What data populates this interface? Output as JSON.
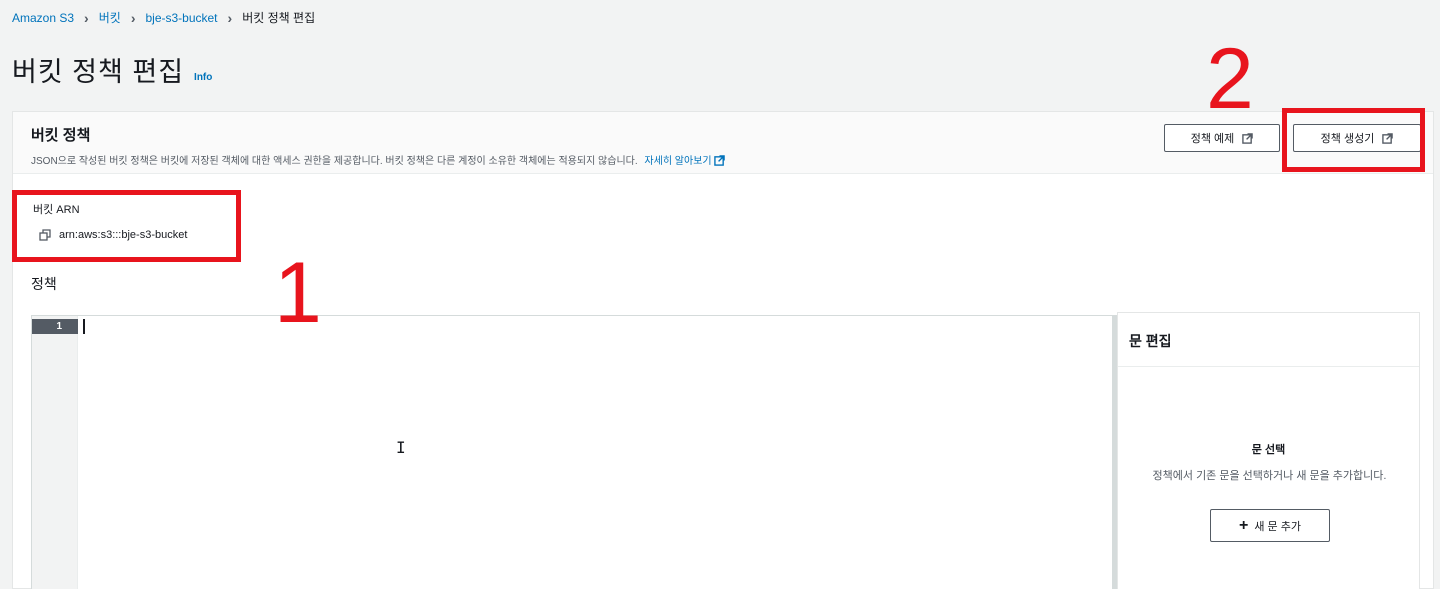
{
  "breadcrumb": {
    "items": [
      "Amazon S3",
      "버킷",
      "bje-s3-bucket",
      "버킷 정책 편집"
    ]
  },
  "page": {
    "title": "버킷 정책 편집",
    "info": "Info"
  },
  "panel": {
    "title": "버킷 정책",
    "description": "JSON으로 작성된 버킷 정책은 버킷에 저장된 객체에 대한 액세스 권한을 제공합니다. 버킷 정책은 다른 계정이 소유한 객체에는 적용되지 않습니다.",
    "learn_more": "자세히 알아보기",
    "example_button": "정책 예제",
    "generator_button": "정책 생성기"
  },
  "arn": {
    "label": "버킷 ARN",
    "value": "arn:aws:s3:::bje-s3-bucket"
  },
  "policy": {
    "label": "정책",
    "line_number": "1"
  },
  "statement": {
    "title": "문 편집",
    "select_title": "문 선택",
    "select_desc": "정책에서 기존 문을 선택하거나 새 문을 추가합니다.",
    "add_button": "새 문 추가"
  },
  "callouts": {
    "one": "1",
    "two": "2"
  },
  "colors": {
    "link": "#0073bb",
    "callout": "#e8141d",
    "background": "#f2f3f3"
  }
}
